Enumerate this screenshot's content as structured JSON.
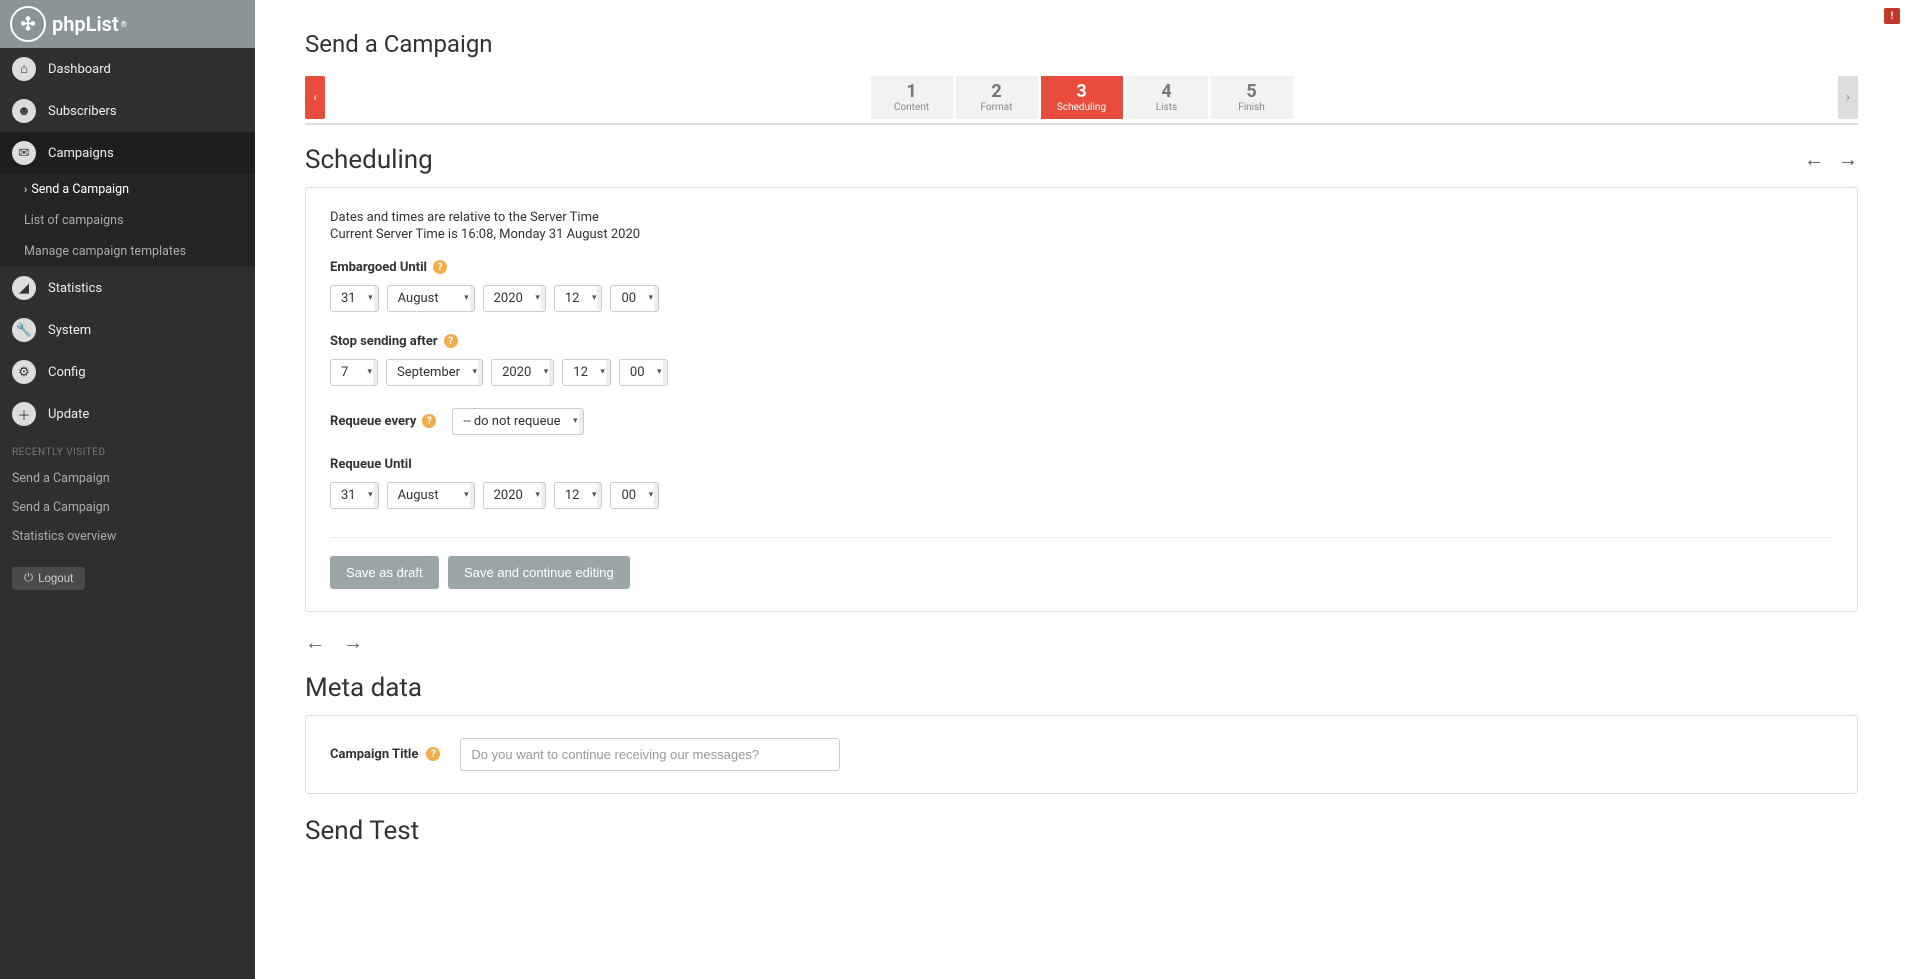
{
  "brand": "phpList",
  "nav": {
    "dashboard": "Dashboard",
    "subscribers": "Subscribers",
    "campaigns": "Campaigns",
    "statistics": "Statistics",
    "system": "System",
    "config": "Config",
    "update": "Update",
    "sub": {
      "send": "Send a Campaign",
      "list": "List of campaigns",
      "templates": "Manage campaign templates"
    },
    "recent_label": "RECENTLY VISITED",
    "recent": [
      "Send a Campaign",
      "Send a Campaign",
      "Statistics overview"
    ],
    "logout": "Logout"
  },
  "page_title": "Send a Campaign",
  "wizard": [
    {
      "num": "1",
      "label": "Content"
    },
    {
      "num": "2",
      "label": "Format"
    },
    {
      "num": "3",
      "label": "Scheduling"
    },
    {
      "num": "4",
      "label": "Lists"
    },
    {
      "num": "5",
      "label": "Finish"
    }
  ],
  "scheduling": {
    "title": "Scheduling",
    "info1": "Dates and times are relative to the Server Time",
    "info2": "Current Server Time is 16:08, Monday 31 August 2020",
    "embargoed_label": "Embargoed Until",
    "embargoed": {
      "day": "31",
      "month": "August",
      "year": "2020",
      "hour": "12",
      "minute": "00"
    },
    "stop_label": "Stop sending after",
    "stop": {
      "day": "7",
      "month": "September",
      "year": "2020",
      "hour": "12",
      "minute": "00"
    },
    "requeue_every_label": "Requeue every",
    "requeue_every_value": "-- do not requeue",
    "requeue_until_label": "Requeue Until",
    "requeue_until": {
      "day": "31",
      "month": "August",
      "year": "2020",
      "hour": "12",
      "minute": "00"
    },
    "save_draft": "Save as draft",
    "save_continue": "Save and continue editing"
  },
  "meta": {
    "title": "Meta data",
    "campaign_title_label": "Campaign Title",
    "campaign_title_placeholder": "Do you want to continue receiving our messages?"
  },
  "send_test_title": "Send Test"
}
